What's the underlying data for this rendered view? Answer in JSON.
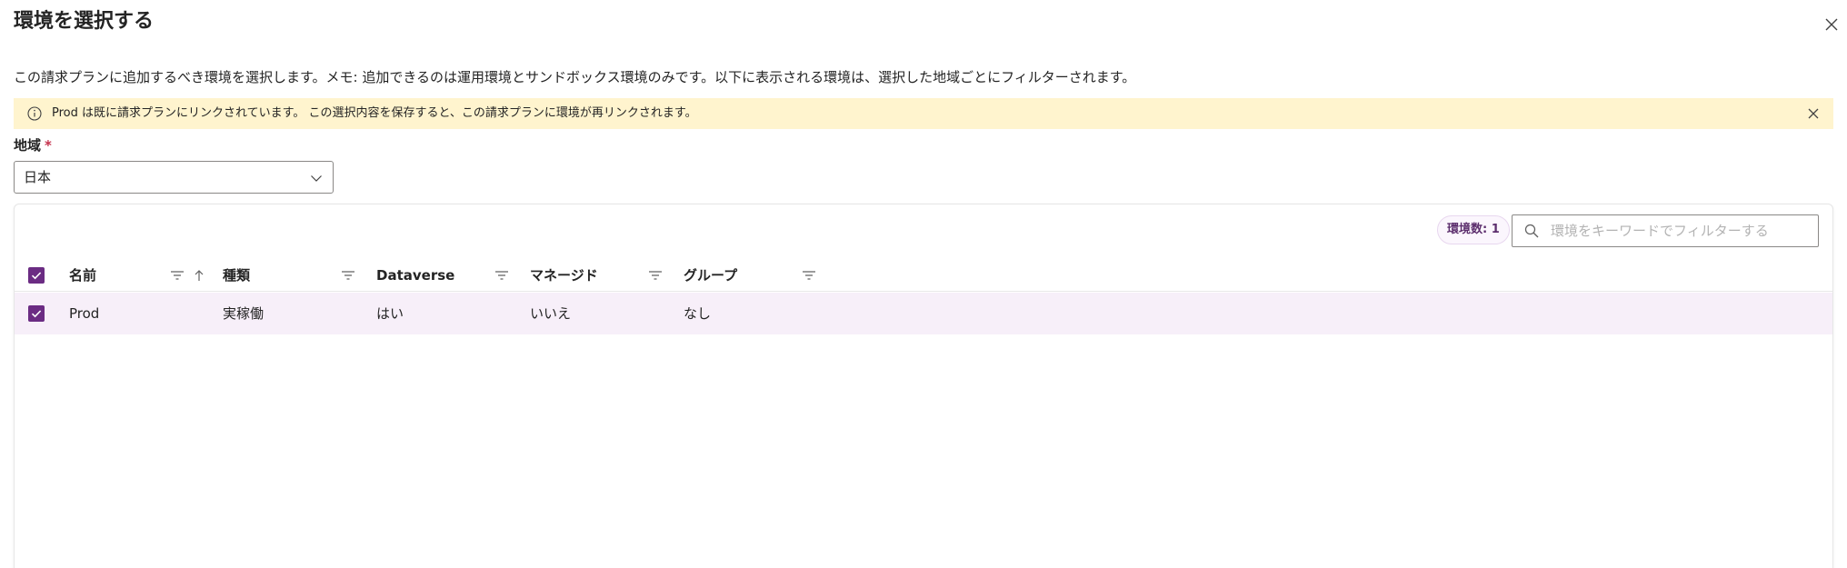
{
  "dialog": {
    "title": "環境を選択する",
    "description": "この請求プランに追加するべき環境を選択します。メモ: 追加できるのは運用環境とサンドボックス環境のみです。以下に表示される環境は、選択した地域ごとにフィルターされます。"
  },
  "warning": {
    "message": "Prod は既に請求プランにリンクされています。 この選択内容を保存すると、この請求プランに環境が再リンクされます。"
  },
  "region": {
    "label": "地域",
    "required_marker": "*",
    "selected": "日本"
  },
  "grid": {
    "count_badge": "環境数: 1",
    "search_placeholder": "環境をキーワードでフィルターする",
    "columns": [
      {
        "label": "名前"
      },
      {
        "label": "種類"
      },
      {
        "label": "Dataverse"
      },
      {
        "label": "マネージド"
      },
      {
        "label": "グループ"
      }
    ],
    "rows": [
      {
        "cells": [
          "Prod",
          "実稼働",
          "はい",
          "いいえ",
          "なし"
        ],
        "selected": true
      }
    ]
  },
  "icons": {
    "close": "close-icon",
    "info": "info-icon",
    "chevron": "chevron-down-icon",
    "search": "search-icon",
    "filter": "filter-icon",
    "sort": "sort-ascending-icon",
    "check": "checkmark-icon"
  },
  "colors": {
    "accent": "#6b2c83",
    "warning_bg": "#fff4ce",
    "selected_row_bg": "#f7eff9",
    "required": "#c4314b"
  }
}
